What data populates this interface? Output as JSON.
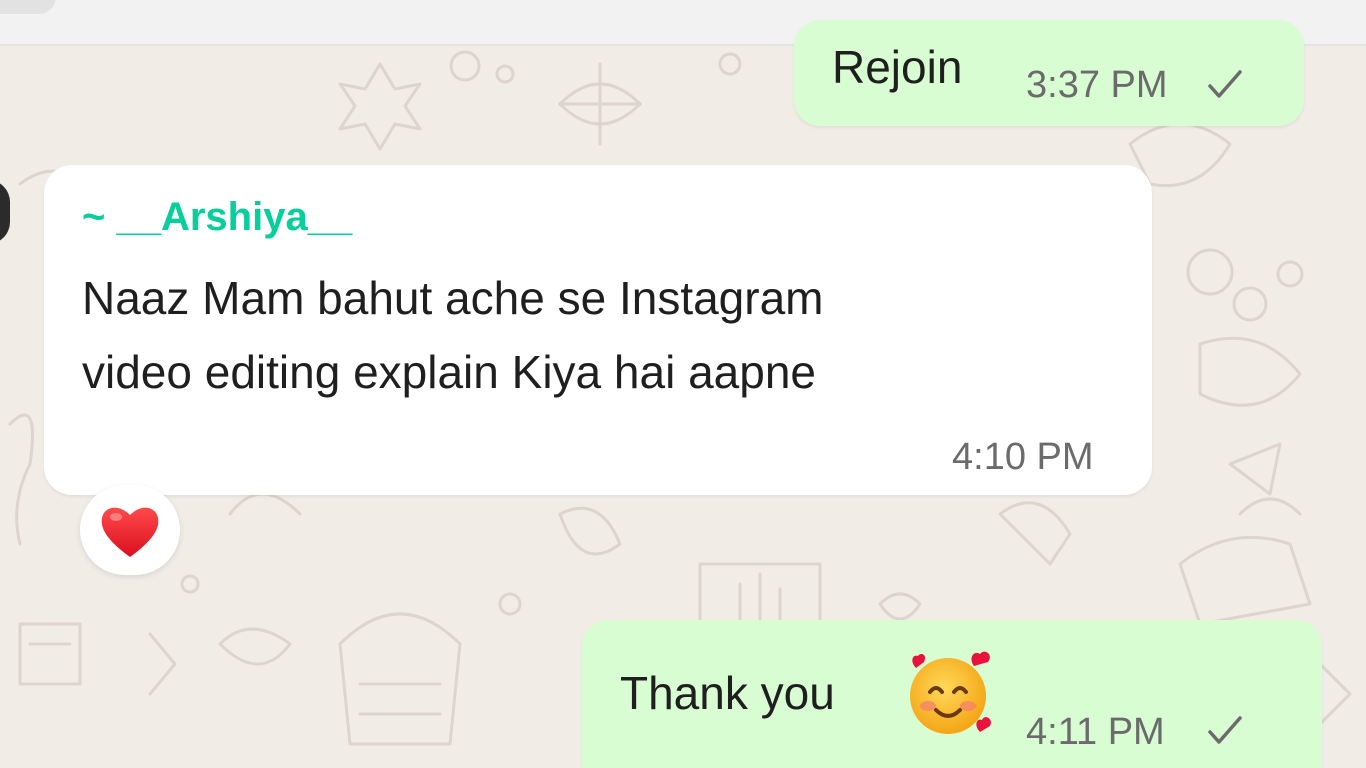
{
  "colors": {
    "chat_background": "#f1ece6",
    "outgoing_bubble": "#d9fdd3",
    "incoming_bubble": "#ffffff",
    "sender_name": "#06cf9c",
    "timestamp": "#6b6b6b"
  },
  "messages": [
    {
      "direction": "outgoing",
      "text": "Rejoin",
      "time": "3:37 PM",
      "status_icon": "single-check-icon"
    },
    {
      "direction": "incoming",
      "sender": "~ __Arshiya__",
      "lines": [
        "Naaz Mam bahut ache se Instagram",
        "video editing explain Kiya hai aapne"
      ],
      "time": "4:10 PM",
      "reaction_icon": "red-heart-icon"
    },
    {
      "direction": "outgoing",
      "text": "Thank you",
      "emoji_icon": "smiling-face-with-hearts-icon",
      "time": "4:11 PM",
      "status_icon": "single-check-icon"
    }
  ]
}
